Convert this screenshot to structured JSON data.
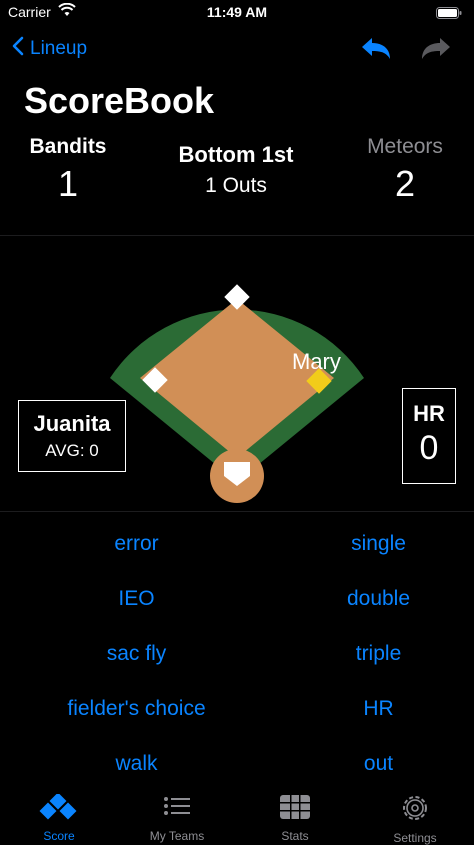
{
  "status_bar": {
    "carrier": "Carrier",
    "time": "11:49 AM"
  },
  "nav": {
    "back_label": "Lineup"
  },
  "title": "ScoreBook",
  "home_team": {
    "name": "Bandits",
    "score": "1"
  },
  "away_team": {
    "name": "Meteors",
    "score": "2"
  },
  "inning": {
    "label": "Bottom 1st",
    "outs": "1 Outs"
  },
  "field": {
    "runner_on_second": "Mary",
    "batter": {
      "name": "Juanita",
      "avg": "AVG: 0"
    },
    "stat": {
      "label": "HR",
      "value": "0"
    }
  },
  "actions": {
    "left": [
      "error",
      "IEO",
      "sac fly",
      "fielder's choice",
      "walk"
    ],
    "right": [
      "single",
      "double",
      "triple",
      "HR",
      "out"
    ]
  },
  "tabs": [
    {
      "label": "Score",
      "icon": "score-diamond-icon",
      "active": true
    },
    {
      "label": "My Teams",
      "icon": "list-icon",
      "active": false
    },
    {
      "label": "Stats",
      "icon": "table-icon",
      "active": false
    },
    {
      "label": "Settings",
      "icon": "gear-icon",
      "active": false
    }
  ],
  "colors": {
    "accent": "#0a84ff",
    "grass": "#2b6b35",
    "infield": "#d18f56",
    "runner": "#f2cc1a",
    "inactive": "#8e8e93"
  }
}
